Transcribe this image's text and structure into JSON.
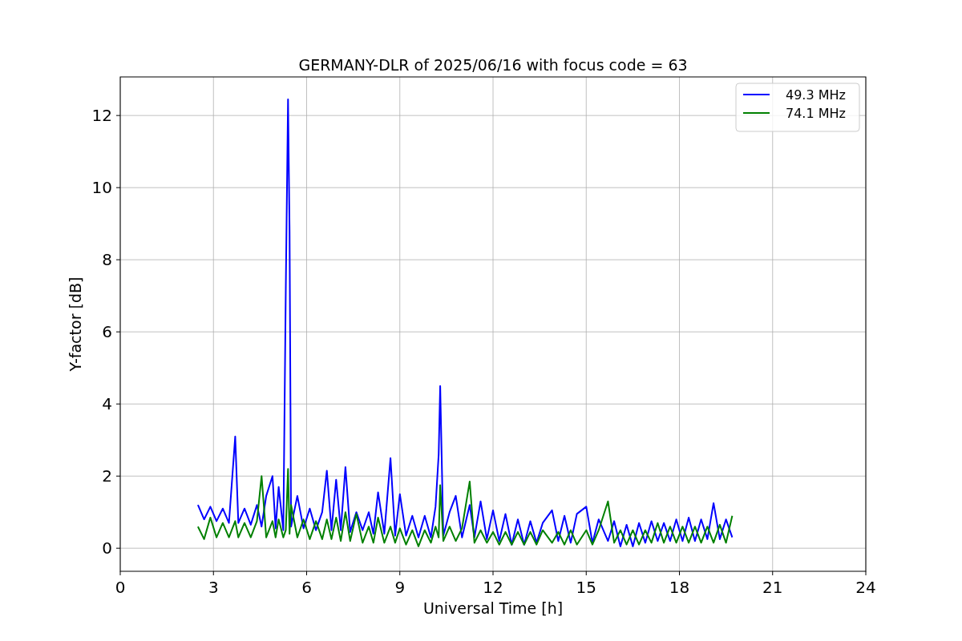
{
  "figure": {
    "chart_data": {
      "type": "line",
      "title": "GERMANY-DLR of 2025/06/16 with focus code = 63",
      "xlabel": "Universal Time [h]",
      "ylabel": "Y-factor [dB]",
      "x": [
        2.5,
        2.7,
        2.9,
        3.1,
        3.3,
        3.5,
        3.7,
        3.8,
        4.0,
        4.2,
        4.4,
        4.55,
        4.7,
        4.9,
        5.0,
        5.1,
        5.25,
        5.33,
        5.4,
        5.45,
        5.5,
        5.7,
        5.9,
        6.1,
        6.3,
        6.5,
        6.65,
        6.8,
        6.95,
        7.1,
        7.25,
        7.4,
        7.6,
        7.8,
        8.0,
        8.15,
        8.3,
        8.5,
        8.7,
        8.85,
        9.0,
        9.2,
        9.4,
        9.6,
        9.8,
        10.0,
        10.15,
        10.25,
        10.3,
        10.4,
        10.6,
        10.8,
        11.0,
        11.25,
        11.4,
        11.6,
        11.8,
        12.0,
        12.2,
        12.4,
        12.6,
        12.8,
        13.0,
        13.2,
        13.4,
        13.6,
        13.9,
        14.1,
        14.3,
        14.5,
        14.7,
        15.0,
        15.2,
        15.4,
        15.7,
        15.9,
        16.1,
        16.3,
        16.5,
        16.7,
        16.9,
        17.1,
        17.3,
        17.5,
        17.7,
        17.9,
        18.1,
        18.3,
        18.5,
        18.7,
        18.9,
        19.1,
        19.3,
        19.5,
        19.7
      ],
      "series": [
        {
          "name": "49.3 MHz",
          "color": "#0000ff",
          "values": [
            1.2,
            0.8,
            1.15,
            0.75,
            1.1,
            0.7,
            3.1,
            0.7,
            1.1,
            0.65,
            1.2,
            0.6,
            1.45,
            2.0,
            0.55,
            1.7,
            0.5,
            7.2,
            12.45,
            8.8,
            0.6,
            1.45,
            0.55,
            1.1,
            0.5,
            1.0,
            2.15,
            0.5,
            1.9,
            0.5,
            2.25,
            0.45,
            1.0,
            0.5,
            1.0,
            0.4,
            1.55,
            0.4,
            2.5,
            0.35,
            1.5,
            0.35,
            0.9,
            0.3,
            0.9,
            0.3,
            1.15,
            2.6,
            4.5,
            0.35,
            1.0,
            1.45,
            0.3,
            1.2,
            0.3,
            1.3,
            0.25,
            1.05,
            0.2,
            0.95,
            0.1,
            0.8,
            0.1,
            0.75,
            0.15,
            0.7,
            1.05,
            0.2,
            0.9,
            0.15,
            0.95,
            1.15,
            0.15,
            0.8,
            0.2,
            0.75,
            0.05,
            0.65,
            0.05,
            0.7,
            0.15,
            0.75,
            0.2,
            0.7,
            0.2,
            0.8,
            0.2,
            0.85,
            0.2,
            0.8,
            0.25,
            1.25,
            0.25,
            0.8,
            0.3
          ]
        },
        {
          "name": "74.1 MHz",
          "color": "#008000",
          "values": [
            0.6,
            0.25,
            0.85,
            0.3,
            0.7,
            0.3,
            0.75,
            0.3,
            0.7,
            0.3,
            0.75,
            2.0,
            0.3,
            0.75,
            0.3,
            0.8,
            0.3,
            0.5,
            2.2,
            0.4,
            1.2,
            0.3,
            0.8,
            0.25,
            0.75,
            0.25,
            0.8,
            0.25,
            0.85,
            0.2,
            1.0,
            0.2,
            0.95,
            0.15,
            0.6,
            0.15,
            0.85,
            0.15,
            0.6,
            0.15,
            0.55,
            0.1,
            0.5,
            0.05,
            0.5,
            0.15,
            0.6,
            0.3,
            1.75,
            0.2,
            0.6,
            0.2,
            0.55,
            1.85,
            0.15,
            0.5,
            0.15,
            0.45,
            0.1,
            0.45,
            0.1,
            0.45,
            0.1,
            0.45,
            0.1,
            0.5,
            0.15,
            0.45,
            0.1,
            0.5,
            0.1,
            0.5,
            0.1,
            0.5,
            1.3,
            0.15,
            0.5,
            0.1,
            0.5,
            0.1,
            0.5,
            0.15,
            0.7,
            0.15,
            0.6,
            0.15,
            0.6,
            0.15,
            0.6,
            0.15,
            0.6,
            0.15,
            0.65,
            0.15,
            0.9
          ]
        }
      ],
      "grid": true,
      "legend": "upper right",
      "xlim": [
        0,
        24
      ],
      "ylim": [
        -0.64,
        13.07
      ],
      "xticks": [
        0,
        3,
        6,
        9,
        12,
        15,
        18,
        21,
        24
      ],
      "yticks": [
        0,
        2,
        4,
        6,
        8,
        10,
        12
      ]
    }
  }
}
